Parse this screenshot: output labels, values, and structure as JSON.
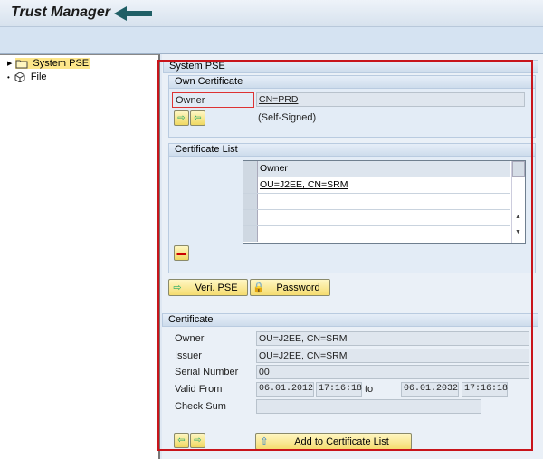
{
  "app": {
    "title": "Trust Manager"
  },
  "tree": {
    "items": [
      {
        "label": "System PSE",
        "icon": "folder-icon",
        "selected": true
      },
      {
        "label": "File",
        "icon": "file-cube-icon"
      }
    ]
  },
  "system_pse": {
    "header": "System PSE"
  },
  "own_certificate": {
    "header": "Own Certificate",
    "owner_label": "Owner",
    "owner_value": "CN=PRD",
    "status": "(Self-Signed)"
  },
  "certificate_list": {
    "header": "Certificate List",
    "column": "Owner",
    "rows": [
      "OU=J2EE, CN=SRM",
      "",
      "",
      ""
    ]
  },
  "buttons": {
    "veri_pse": "Veri. PSE",
    "password": "Password",
    "add_to_list": "Add to Certificate List"
  },
  "certificate": {
    "header": "Certificate",
    "owner_label": "Owner",
    "owner": "OU=J2EE, CN=SRM",
    "issuer_label": "Issuer",
    "issuer": "OU=J2EE, CN=SRM",
    "serial_label": "Serial Number",
    "serial": "00",
    "valid_label": "Valid From",
    "valid_from_date": "06.01.2012",
    "valid_from_time": "17:16:18",
    "to_label": "to",
    "valid_to_date": "06.01.2032",
    "valid_to_time": "17:16:18",
    "checksum_label": "Check Sum",
    "checksum": ""
  },
  "colors": {
    "highlight_box": "#c8141b",
    "arrow": "#1f5f66"
  }
}
